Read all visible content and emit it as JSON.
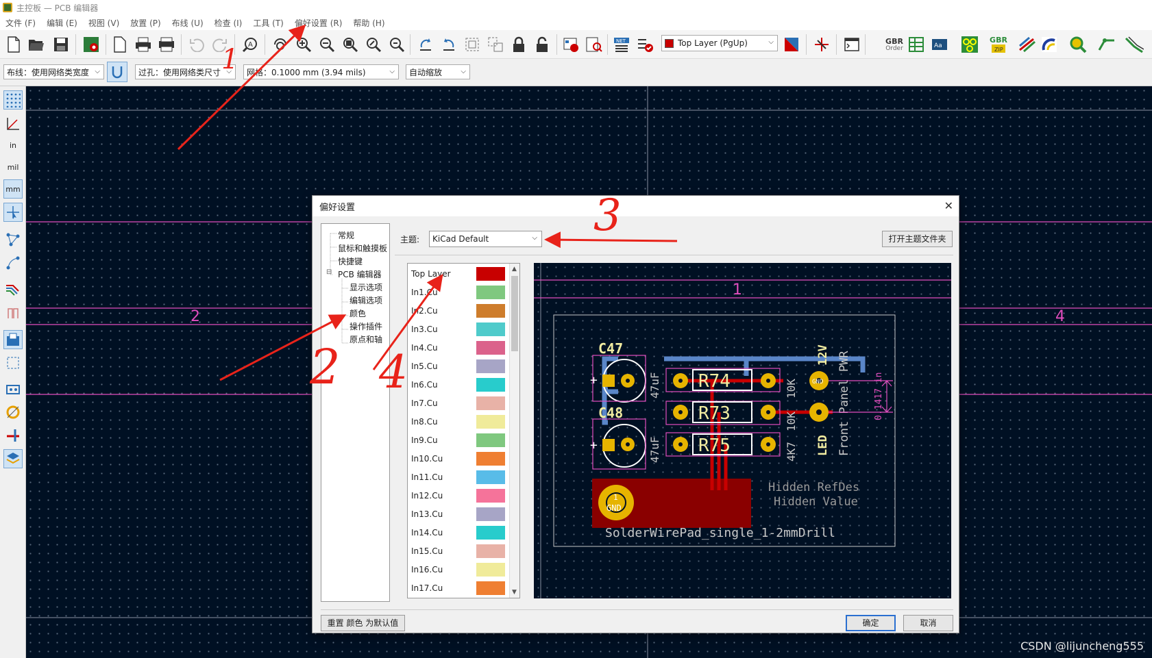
{
  "window": {
    "title": "主控板 — PCB 编辑器",
    "app_icon": "kicad-pcb-icon"
  },
  "menu": [
    "文件 (F)",
    "编辑 (E)",
    "视图 (V)",
    "放置 (P)",
    "布线 (U)",
    "检查 (I)",
    "工具 (T)",
    "偏好设置 (R)",
    "帮助 (H)"
  ],
  "toolbar": {
    "layer_combo": "Top Layer (PgUp)",
    "gbr_order": [
      "GBR",
      "Order"
    ],
    "gbr_zip": "GBR",
    "layer_color": "#c80000"
  },
  "toolbar2": {
    "track": "布线：使用网络类宽度",
    "via": "过孔：使用网络类尺寸",
    "grid": "网格：0.1000 mm (3.94 mils)",
    "zoom": "自动缩放"
  },
  "lefttool_units": [
    "in",
    "mil",
    "mm"
  ],
  "canvas": {
    "zone_labels": [
      "2",
      "4"
    ]
  },
  "dialog": {
    "title": "偏好设置",
    "tree": [
      {
        "label": "常规",
        "level": 1
      },
      {
        "label": "鼠标和触摸板",
        "level": 1
      },
      {
        "label": "快捷键",
        "level": 1
      },
      {
        "label": "PCB 编辑器",
        "level": 1,
        "expander": "⊟"
      },
      {
        "label": "显示选项",
        "level": 2
      },
      {
        "label": "编辑选项",
        "level": 2
      },
      {
        "label": "颜色",
        "level": 2
      },
      {
        "label": "操作插件",
        "level": 2
      },
      {
        "label": "原点和轴",
        "level": 2
      }
    ],
    "theme_label": "主题:",
    "theme_value": "KiCad Default",
    "open_folder": "打开主题文件夹",
    "layers": [
      {
        "name": "Top Layer",
        "color": "#c80000"
      },
      {
        "name": "In1.Cu",
        "color": "#7fc87f"
      },
      {
        "name": "In2.Cu",
        "color": "#ce7d2c"
      },
      {
        "name": "In3.Cu",
        "color": "#4fcbcb"
      },
      {
        "name": "In4.Cu",
        "color": "#db628b"
      },
      {
        "name": "In5.Cu",
        "color": "#a7a5c6"
      },
      {
        "name": "In6.Cu",
        "color": "#28cccc"
      },
      {
        "name": "In7.Cu",
        "color": "#e8b2a7"
      },
      {
        "name": "In8.Cu",
        "color": "#f0eb9a"
      },
      {
        "name": "In9.Cu",
        "color": "#7fc87f"
      },
      {
        "name": "In10.Cu",
        "color": "#ef7f32"
      },
      {
        "name": "In11.Cu",
        "color": "#58bce8"
      },
      {
        "name": "In12.Cu",
        "color": "#f5739a"
      },
      {
        "name": "In13.Cu",
        "color": "#a7a5c6"
      },
      {
        "name": "In14.Cu",
        "color": "#28cccc"
      },
      {
        "name": "In15.Cu",
        "color": "#e8b2a7"
      },
      {
        "name": "In16.Cu",
        "color": "#f0eb9a"
      },
      {
        "name": "In17.Cu",
        "color": "#ef7f32"
      }
    ],
    "preview": {
      "zone_label": "1",
      "refs": [
        "C47",
        "C48",
        "R74",
        "R73",
        "R75"
      ],
      "values": [
        "47uF",
        "47uF",
        "10K",
        "10K",
        "4K7"
      ],
      "pad_labels": [
        "GND",
        "1",
        "2"
      ],
      "net_labels": [
        "12V",
        "LED",
        "Front Panel PWR"
      ],
      "dimension": "0.1417 in",
      "hidden_refdes": "Hidden RefDes",
      "hidden_value": "Hidden Value",
      "footprint_name": "SolderWirePad_single_1-2mmDrill"
    },
    "reset_button": "重置 颜色 为默认值",
    "ok_button": "确定",
    "cancel_button": "取消"
  },
  "annotations": [
    "1",
    "2",
    "3",
    "4"
  ],
  "watermark": "CSDN @lijuncheng555"
}
